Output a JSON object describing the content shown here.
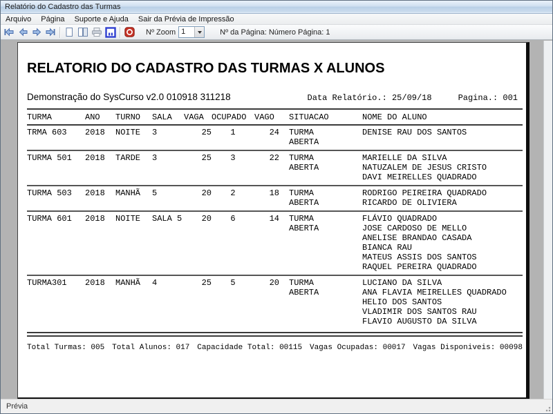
{
  "window": {
    "title": "Relatório do Cadastro das Turmas"
  },
  "menu": {
    "items": [
      "Arquivo",
      "Página",
      "Suporte e Ajuda",
      "Sair da Prévia de Impressão"
    ]
  },
  "toolbar": {
    "icon_names": [
      "first-page-icon",
      "prev-page-icon",
      "next-page-icon",
      "last-page-icon",
      "single-page-icon",
      "double-page-icon",
      "printer-icon",
      "print-setup-icon",
      "exit-preview-icon"
    ],
    "zoom_label": "Nº Zoom",
    "zoom_value": "1",
    "page_info": "Nº da Página: Número Página: 1"
  },
  "statusbar": {
    "text": "Prévia"
  },
  "colors": {
    "titlebar_blue": "#c5d8ec",
    "toolbar_arrow_blue": "#8fb0dd",
    "exit_red": "#c43226",
    "setup_blue": "#2f3fd0",
    "workspace_gray": "#b3b3b3"
  },
  "report": {
    "title": "RELATORIO DO CADASTRO DAS TURMAS X ALUNOS",
    "subtitle": "Demonstração do SysCurso v2.0 010918 311218",
    "date_label": "Data Relatório.: 25/09/18",
    "page_label": "Pagina.: 001",
    "columns": [
      "TURMA",
      "ANO",
      "TURNO",
      "SALA",
      "VAGA",
      "OCUPADO",
      "VAGO",
      "SITUACAO",
      "NOME DO ALUNO"
    ],
    "rows": [
      {
        "turma": "TRMA 603",
        "ano": "2018",
        "turno": "NOITE",
        "sala": "3",
        "vaga": "25",
        "ocupado": "1",
        "vago": "24",
        "situacao": "TURMA ABERTA",
        "alunos": [
          "DENISE RAU DOS SANTOS"
        ]
      },
      {
        "turma": "TURMA 501",
        "ano": "2018",
        "turno": "TARDE",
        "sala": "3",
        "vaga": "25",
        "ocupado": "3",
        "vago": "22",
        "situacao": "TURMA ABERTA",
        "alunos": [
          "MARIELLE DA SILVA",
          "NATUZALEM DE JESUS CRISTO",
          "DAVI MEIRELLES QUADRADO"
        ]
      },
      {
        "turma": "TURMA 503",
        "ano": "2018",
        "turno": "MANHÃ",
        "sala": "5",
        "vaga": "20",
        "ocupado": "2",
        "vago": "18",
        "situacao": "TURMA ABERTA",
        "alunos": [
          "RODRIGO PEIREIRA QUADRADO",
          "RICARDO DE OLIVIERA"
        ]
      },
      {
        "turma": "TURMA 601",
        "ano": "2018",
        "turno": "NOITE",
        "sala": "SALA 5",
        "vaga": "20",
        "ocupado": "6",
        "vago": "14",
        "situacao": "TURMA ABERTA",
        "alunos": [
          "FLÁVIO QUADRADO",
          "JOSE CARDOSO DE MELLO",
          "ANELISE BRANDAO CASADA",
          "BIANCA RAU",
          "MATEUS ASSIS DOS SANTOS",
          "RAQUEL PEREIRA QUADRADO"
        ]
      },
      {
        "turma": "TURMA301",
        "ano": "2018",
        "turno": "MANHÃ",
        "sala": "4",
        "vaga": "25",
        "ocupado": "5",
        "vago": "20",
        "situacao": "TURMA ABERTA",
        "alunos": [
          "LUCIANO DA SILVA",
          "ANA FLAVIA MEIRELLES QUADRADO",
          "HELIO DOS SANTOS",
          "VLADIMIR DOS SANTOS RAU",
          "FLAVIO AUGUSTO DA SILVA"
        ]
      }
    ],
    "totals": [
      "Total Turmas: 005",
      "Total Alunos: 017",
      "Capacidade Total: 00115",
      "Vagas Ocupadas: 00017",
      "Vagas Disponiveis: 00098"
    ]
  }
}
